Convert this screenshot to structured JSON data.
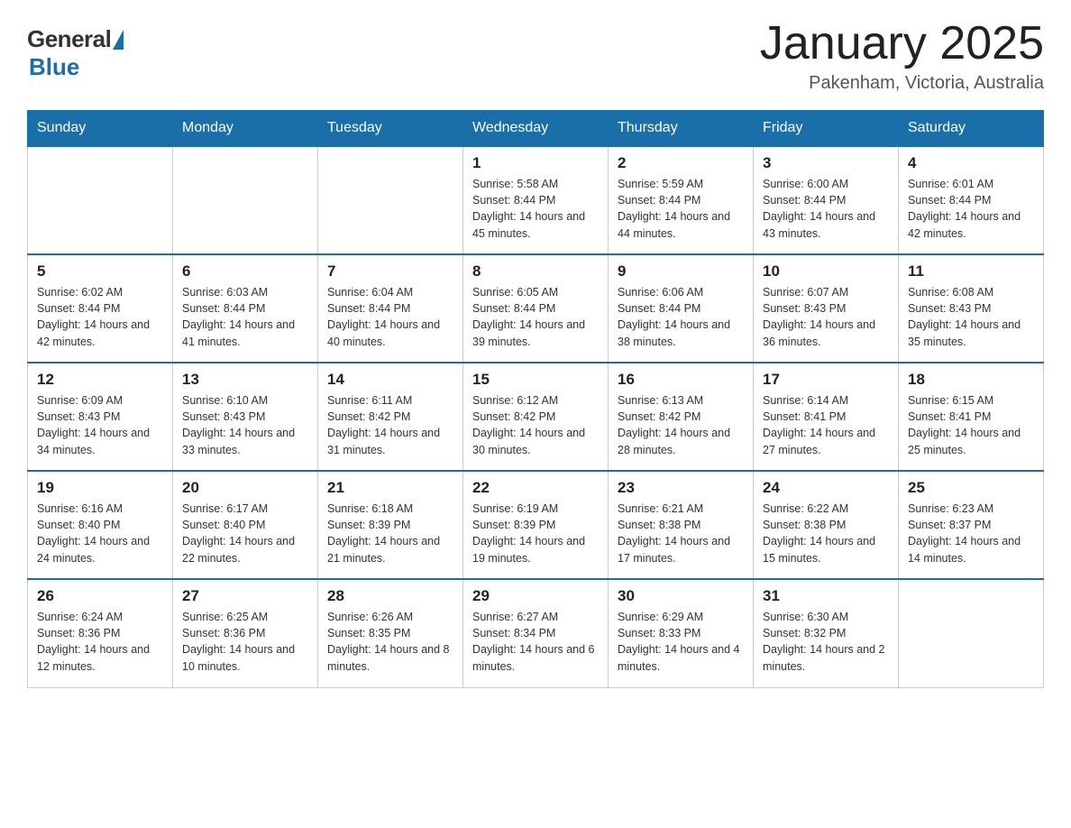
{
  "logo": {
    "general": "General",
    "blue": "Blue"
  },
  "header": {
    "title": "January 2025",
    "subtitle": "Pakenham, Victoria, Australia"
  },
  "days_of_week": [
    "Sunday",
    "Monday",
    "Tuesday",
    "Wednesday",
    "Thursday",
    "Friday",
    "Saturday"
  ],
  "weeks": [
    [
      {
        "day": "",
        "info": ""
      },
      {
        "day": "",
        "info": ""
      },
      {
        "day": "",
        "info": ""
      },
      {
        "day": "1",
        "info": "Sunrise: 5:58 AM\nSunset: 8:44 PM\nDaylight: 14 hours and 45 minutes."
      },
      {
        "day": "2",
        "info": "Sunrise: 5:59 AM\nSunset: 8:44 PM\nDaylight: 14 hours and 44 minutes."
      },
      {
        "day": "3",
        "info": "Sunrise: 6:00 AM\nSunset: 8:44 PM\nDaylight: 14 hours and 43 minutes."
      },
      {
        "day": "4",
        "info": "Sunrise: 6:01 AM\nSunset: 8:44 PM\nDaylight: 14 hours and 42 minutes."
      }
    ],
    [
      {
        "day": "5",
        "info": "Sunrise: 6:02 AM\nSunset: 8:44 PM\nDaylight: 14 hours and 42 minutes."
      },
      {
        "day": "6",
        "info": "Sunrise: 6:03 AM\nSunset: 8:44 PM\nDaylight: 14 hours and 41 minutes."
      },
      {
        "day": "7",
        "info": "Sunrise: 6:04 AM\nSunset: 8:44 PM\nDaylight: 14 hours and 40 minutes."
      },
      {
        "day": "8",
        "info": "Sunrise: 6:05 AM\nSunset: 8:44 PM\nDaylight: 14 hours and 39 minutes."
      },
      {
        "day": "9",
        "info": "Sunrise: 6:06 AM\nSunset: 8:44 PM\nDaylight: 14 hours and 38 minutes."
      },
      {
        "day": "10",
        "info": "Sunrise: 6:07 AM\nSunset: 8:43 PM\nDaylight: 14 hours and 36 minutes."
      },
      {
        "day": "11",
        "info": "Sunrise: 6:08 AM\nSunset: 8:43 PM\nDaylight: 14 hours and 35 minutes."
      }
    ],
    [
      {
        "day": "12",
        "info": "Sunrise: 6:09 AM\nSunset: 8:43 PM\nDaylight: 14 hours and 34 minutes."
      },
      {
        "day": "13",
        "info": "Sunrise: 6:10 AM\nSunset: 8:43 PM\nDaylight: 14 hours and 33 minutes."
      },
      {
        "day": "14",
        "info": "Sunrise: 6:11 AM\nSunset: 8:42 PM\nDaylight: 14 hours and 31 minutes."
      },
      {
        "day": "15",
        "info": "Sunrise: 6:12 AM\nSunset: 8:42 PM\nDaylight: 14 hours and 30 minutes."
      },
      {
        "day": "16",
        "info": "Sunrise: 6:13 AM\nSunset: 8:42 PM\nDaylight: 14 hours and 28 minutes."
      },
      {
        "day": "17",
        "info": "Sunrise: 6:14 AM\nSunset: 8:41 PM\nDaylight: 14 hours and 27 minutes."
      },
      {
        "day": "18",
        "info": "Sunrise: 6:15 AM\nSunset: 8:41 PM\nDaylight: 14 hours and 25 minutes."
      }
    ],
    [
      {
        "day": "19",
        "info": "Sunrise: 6:16 AM\nSunset: 8:40 PM\nDaylight: 14 hours and 24 minutes."
      },
      {
        "day": "20",
        "info": "Sunrise: 6:17 AM\nSunset: 8:40 PM\nDaylight: 14 hours and 22 minutes."
      },
      {
        "day": "21",
        "info": "Sunrise: 6:18 AM\nSunset: 8:39 PM\nDaylight: 14 hours and 21 minutes."
      },
      {
        "day": "22",
        "info": "Sunrise: 6:19 AM\nSunset: 8:39 PM\nDaylight: 14 hours and 19 minutes."
      },
      {
        "day": "23",
        "info": "Sunrise: 6:21 AM\nSunset: 8:38 PM\nDaylight: 14 hours and 17 minutes."
      },
      {
        "day": "24",
        "info": "Sunrise: 6:22 AM\nSunset: 8:38 PM\nDaylight: 14 hours and 15 minutes."
      },
      {
        "day": "25",
        "info": "Sunrise: 6:23 AM\nSunset: 8:37 PM\nDaylight: 14 hours and 14 minutes."
      }
    ],
    [
      {
        "day": "26",
        "info": "Sunrise: 6:24 AM\nSunset: 8:36 PM\nDaylight: 14 hours and 12 minutes."
      },
      {
        "day": "27",
        "info": "Sunrise: 6:25 AM\nSunset: 8:36 PM\nDaylight: 14 hours and 10 minutes."
      },
      {
        "day": "28",
        "info": "Sunrise: 6:26 AM\nSunset: 8:35 PM\nDaylight: 14 hours and 8 minutes."
      },
      {
        "day": "29",
        "info": "Sunrise: 6:27 AM\nSunset: 8:34 PM\nDaylight: 14 hours and 6 minutes."
      },
      {
        "day": "30",
        "info": "Sunrise: 6:29 AM\nSunset: 8:33 PM\nDaylight: 14 hours and 4 minutes."
      },
      {
        "day": "31",
        "info": "Sunrise: 6:30 AM\nSunset: 8:32 PM\nDaylight: 14 hours and 2 minutes."
      },
      {
        "day": "",
        "info": ""
      }
    ]
  ]
}
